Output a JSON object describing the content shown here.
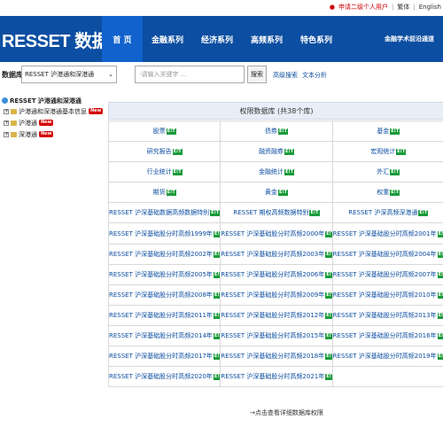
{
  "topbar": {
    "apply": "申请二级个人用户",
    "links": [
      "繁体",
      "English"
    ],
    "partial_link": "繁体 | English"
  },
  "header": {
    "logo": "RESSET 数据库",
    "nav": [
      "首 页",
      "金融系列",
      "经济系列",
      "高频系列",
      "特色系列"
    ],
    "right": "金融学术前沿通道"
  },
  "search": {
    "db_label": "数据库",
    "db_selected": "RESSET 沪港通和深港通",
    "placeholder": "-请输入关键字 ...",
    "button": "搜索",
    "advanced": "高级搜索",
    "text_analysis": "文本分析"
  },
  "tree": {
    "root": "RESSET 沪港通和深港通",
    "items": [
      {
        "label": "沪港通和深港通基本信息",
        "new": "New"
      },
      {
        "label": "沪港通",
        "new": "New"
      },
      {
        "label": "深港通",
        "new": "New"
      }
    ]
  },
  "panel": {
    "title": "权限数据库 (共38个库)",
    "badge": "E!T",
    "rows": [
      [
        "股票",
        "债券",
        "基金"
      ],
      [
        "研究报告",
        "融资融券",
        "宏观统计"
      ],
      [
        "行业统计",
        "金融统计",
        "外汇"
      ],
      [
        "期货",
        "黄金",
        "权重"
      ],
      [
        "RESSET 沪深基础数据高频数据特别",
        "RESSET 期权高频数据特别",
        "RESSET 沪深高频深港通"
      ],
      [
        "RESSET 沪深基础股分时高频1999年",
        "RESSET 沪深基础股分时高频2000年",
        "RESSET 沪深基础股分时高频2001年"
      ],
      [
        "RESSET 沪深基础股分时高频2002年",
        "RESSET 沪深基础股分时高频2003年",
        "RESSET 沪深基础股分时高频2004年"
      ],
      [
        "RESSET 沪深基础股分时高频2005年",
        "RESSET 沪深基础股分时高频2006年",
        "RESSET 沪深基础股分时高频2007年"
      ],
      [
        "RESSET 沪深基础股分时高频2008年",
        "RESSET 沪深基础股分时高频2009年",
        "RESSET 沪深基础股分时高频2010年"
      ],
      [
        "RESSET 沪深基础股分时高频2011年",
        "RESSET 沪深基础股分时高频2012年",
        "RESSET 沪深基础股分时高频2013年"
      ],
      [
        "RESSET 沪深基础股分时高频2014年",
        "RESSET 沪深基础股分时高频2015年",
        "RESSET 沪深基础股分时高频2016年"
      ],
      [
        "RESSET 沪深基础股分时高频2017年",
        "RESSET 沪深基础股分时高频2018年",
        "RESSET 沪深基础股分时高频2019年"
      ],
      [
        "RESSET 沪深基础股分时高频2020年",
        "RESSET 沪深基础股分时高频2021年",
        ""
      ]
    ]
  },
  "footer": {
    "link": "→点击查看详细数据库权限"
  },
  "colors": {
    "nav_bg": "#0c4ea1",
    "nav_active": "#1162cc",
    "badge": "#1a9b3a",
    "new": "#d40000"
  }
}
